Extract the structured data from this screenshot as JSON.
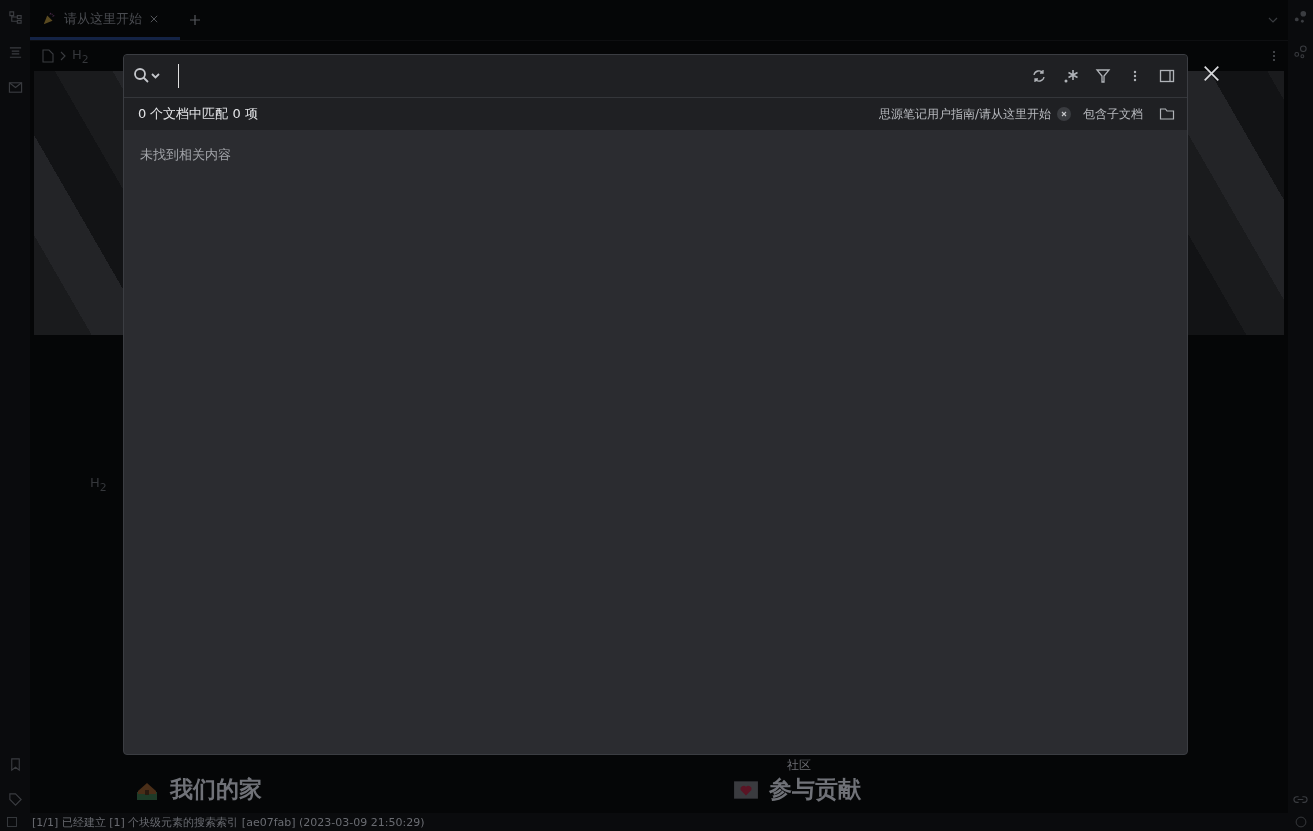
{
  "tabs": [
    {
      "label": "请从这里开始",
      "selected": true
    }
  ],
  "breadcrumb": {
    "heading": "H$_{2}$"
  },
  "editor": {
    "heading_marker": "H$_{2}$",
    "community_link": "社区",
    "sections": [
      {
        "kind": "home",
        "title": "我们的家"
      },
      {
        "kind": "contribute",
        "title": "参与贡献"
      }
    ]
  },
  "search_dialog": {
    "match_summary": "0 个文档中匹配 0 项",
    "path_filter": "思源笔记用户指南/请从这里开始",
    "include_children": "包含子文档",
    "empty_message": "未找到相关内容"
  },
  "status_bar": {
    "message": "[1/1] 已经建立 [1] 个块级元素的搜索索引 [ae07fab] (2023-03-09 21:50:29)"
  }
}
